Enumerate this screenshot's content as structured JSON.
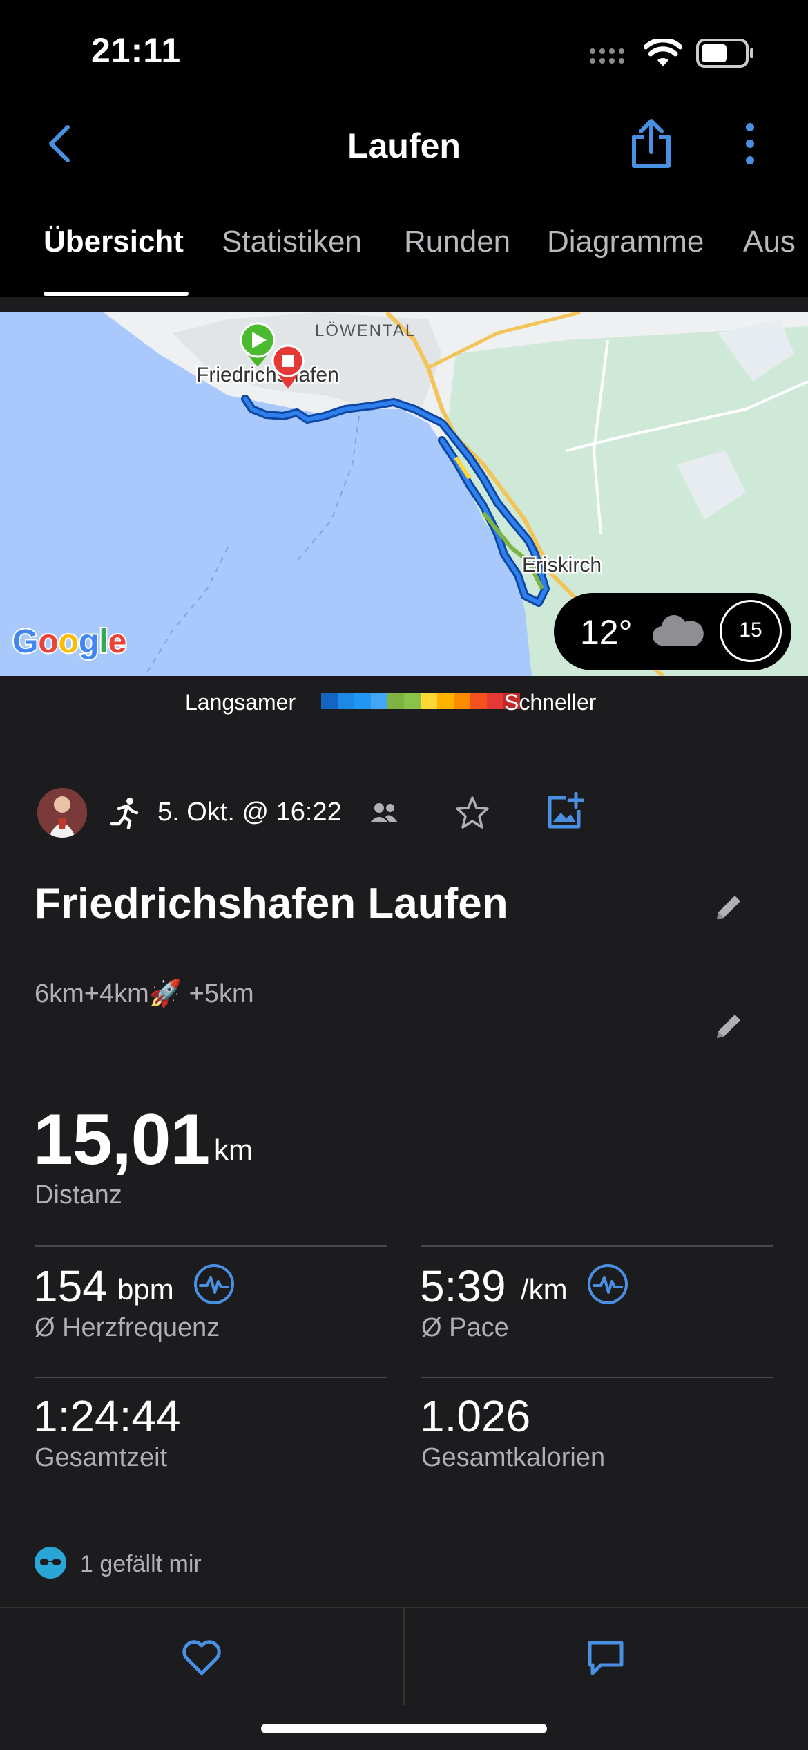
{
  "status_bar": {
    "time": "21:11"
  },
  "nav": {
    "title": "Laufen"
  },
  "tabs": [
    "Übersicht",
    "Statistiken",
    "Runden",
    "Diagramme",
    "Aus"
  ],
  "map": {
    "labels": {
      "district": "LÖWENTAL",
      "city": "Friedrichshafen",
      "town": "Eriskirch"
    },
    "provider": "Google",
    "weather": {
      "temp": "12°",
      "wind": "15"
    }
  },
  "legend": {
    "slower": "Langsamer",
    "faster": "Schneller",
    "colors": [
      "#1565c0",
      "#1e88e5",
      "#2196f3",
      "#42a5f5",
      "#7cb342",
      "#8bc34a",
      "#fdd835",
      "#ffb300",
      "#fb8c00",
      "#f4511e",
      "#e53935",
      "#c62828"
    ]
  },
  "activity": {
    "date": "5. Okt. @ 16:22",
    "title": "Friedrichshafen Laufen",
    "description": "6km+4km🚀 +5km"
  },
  "distance": {
    "value": "15,01",
    "unit": "km",
    "label": "Distanz"
  },
  "stats": {
    "heart_rate": {
      "value": "154",
      "unit": "bpm",
      "label": "Ø Herzfrequenz"
    },
    "pace": {
      "value": "5:39",
      "unit": "/km",
      "label": "Ø Pace"
    },
    "total_time": {
      "value": "1:24:44",
      "label": "Gesamtzeit"
    },
    "calories": {
      "value": "1.026",
      "label": "Gesamtkalorien"
    }
  },
  "likes": {
    "text": "1 gefällt mir"
  },
  "colors": {
    "accent": "#4a90e2",
    "background": "#1c1c1e"
  }
}
